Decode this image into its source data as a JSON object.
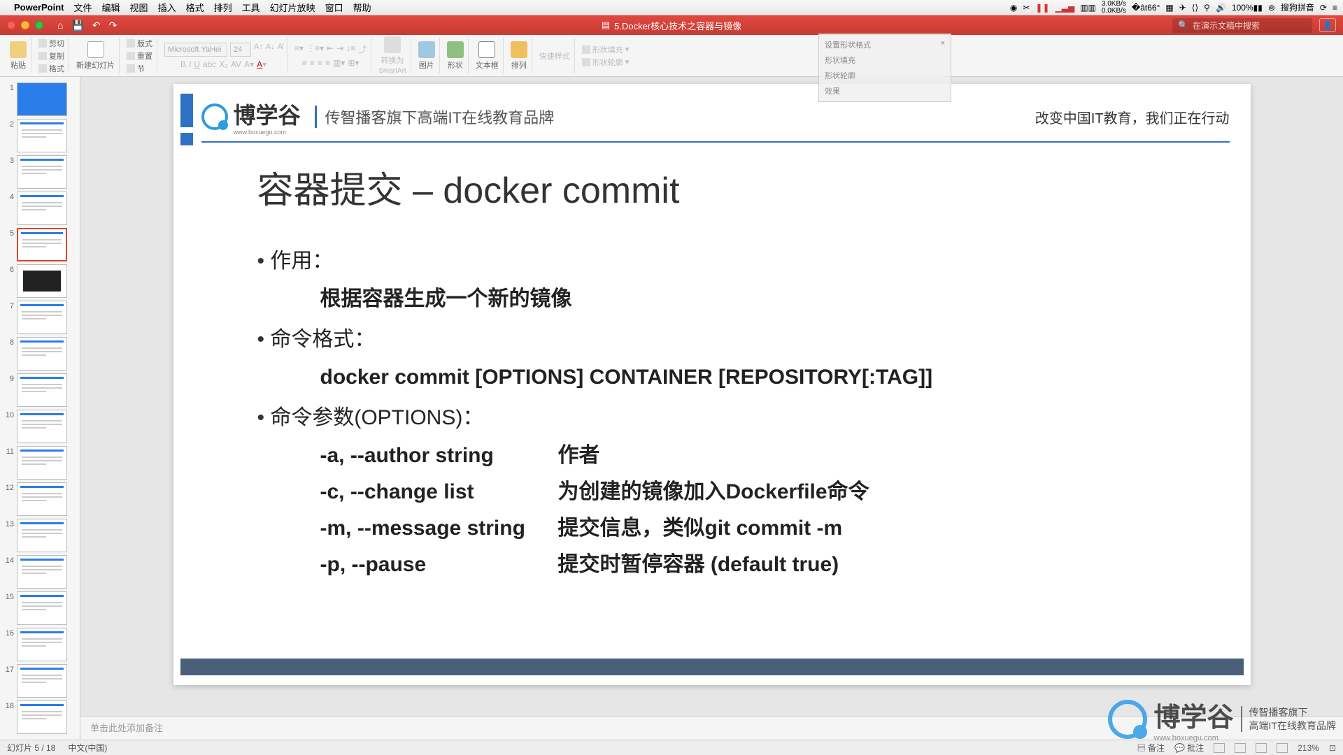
{
  "menubar": {
    "app": "PowerPoint",
    "items": [
      "文件",
      "编辑",
      "视图",
      "插入",
      "格式",
      "排列",
      "工具",
      "幻灯片放映",
      "窗口",
      "帮助"
    ],
    "right": {
      "net_up": "3.0KB/s",
      "net_down": "0.0KB/s",
      "temp": "66°",
      "battery": "100%",
      "ime": "搜狗拼音",
      "clock": ""
    }
  },
  "titlebar": {
    "doc": "5.Docker核心技术之容器与镜像",
    "search_placeholder": "在演示文稿中搜索"
  },
  "ribbon": {
    "paste": "粘贴",
    "cut": "剪切",
    "copy": "复制",
    "format": "格式",
    "newslide": "新建幻灯片",
    "layout": "版式",
    "reset": "重置",
    "section": "节",
    "font_name": "Microsoft YaHei",
    "font_size": "24",
    "smartart": "转换为",
    "smartart2": "SmartArt",
    "picture": "图片",
    "shape": "形状",
    "textbox": "文本框",
    "arrange": "排列",
    "quickstyle": "快速样式",
    "shapefill": "形状填充",
    "shapeoutline": "形状轮廓"
  },
  "thumbnails": {
    "count": 18,
    "selected": 5
  },
  "slide": {
    "logo": "博学谷",
    "logo_sub": "www.boxuegu.com",
    "brand_tag": "传智播客旗下高端IT在线教育品牌",
    "slogan": "改变中国IT教育，我们正在行动",
    "title": "容器提交 – docker commit",
    "section1": "作用：",
    "section1_body": "根据容器生成一个新的镜像",
    "section2": "命令格式：",
    "section2_body": "docker commit [OPTIONS] CONTAINER [REPOSITORY[:TAG]]",
    "section3": "命令参数(OPTIONS)：",
    "options": [
      {
        "flag": "-a, --author string",
        "desc": "作者"
      },
      {
        "flag": "-c, --change list",
        "desc": "为创建的镜像加入Dockerfile命令"
      },
      {
        "flag": "-m, --message string",
        "desc": "提交信息，类似git commit -m"
      },
      {
        "flag": "-p, --pause",
        "desc": "提交时暂停容器 (default true)"
      }
    ]
  },
  "notes": {
    "placeholder": "单击此处添加备注"
  },
  "statusbar": {
    "slide_info": "幻灯片 5 / 18",
    "lang": "中文(中国)",
    "notes_btn": "备注",
    "comments_btn": "批注",
    "zoom": "213%"
  },
  "watermark": {
    "text": "博学谷",
    "sub1": "传智播客旗下",
    "sub2": "高端IT在线教育品牌",
    "url": "www.boxuegu.com"
  },
  "float_panel": {
    "title": "设置形状格式",
    "row1": "形状填充",
    "row2": "形状轮廓",
    "row3": "效果"
  }
}
